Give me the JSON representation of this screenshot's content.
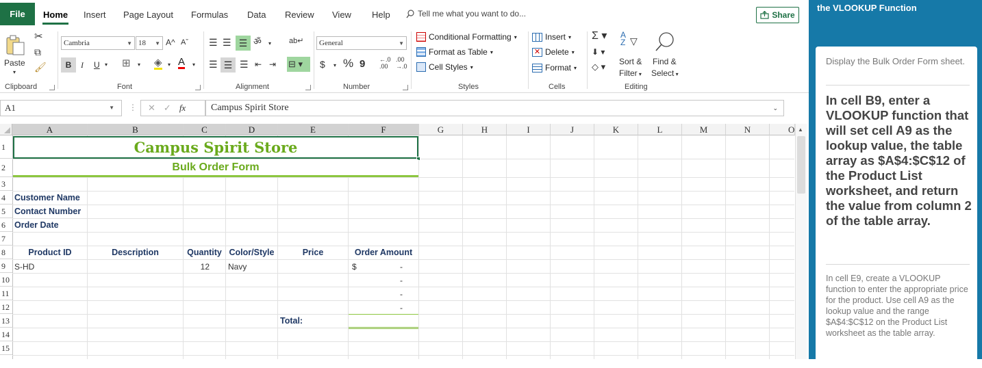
{
  "tabs": {
    "file": "File",
    "items": [
      "Home",
      "Insert",
      "Page Layout",
      "Formulas",
      "Data",
      "Review",
      "View",
      "Help"
    ],
    "tell_me": "Tell me what you want to do...",
    "share": "Share"
  },
  "ribbon": {
    "clipboard": {
      "paste": "Paste",
      "label": "Clipboard"
    },
    "font": {
      "name": "Cambria",
      "size": "18",
      "bold": "B",
      "italic": "I",
      "underline": "U",
      "grow": "A^",
      "shrink": "Aˇ",
      "label": "Font"
    },
    "alignment": {
      "label": "Alignment"
    },
    "number": {
      "format": "General",
      "currency": "$",
      "percent": "%",
      "comma": "9",
      "label": "Number"
    },
    "styles": {
      "conditional": "Conditional Formatting",
      "table": "Format as Table",
      "cell_styles": "Cell Styles",
      "label": "Styles"
    },
    "cells": {
      "insert": "Insert",
      "delete": "Delete",
      "format": "Format",
      "label": "Cells"
    },
    "editing": {
      "sort1": "Sort &",
      "sort2": "Filter",
      "find1": "Find &",
      "find2": "Select",
      "label": "Editing"
    }
  },
  "formula_bar": {
    "name_box": "A1",
    "fx": "fx",
    "content": "Campus Spirit Store"
  },
  "columns": [
    "A",
    "B",
    "C",
    "D",
    "E",
    "F",
    "G",
    "H",
    "I",
    "J",
    "K",
    "L",
    "M",
    "N",
    "O"
  ],
  "rows": [
    "1",
    "2",
    "3",
    "4",
    "5",
    "6",
    "7",
    "8",
    "9",
    "10",
    "11",
    "12",
    "13",
    "14",
    "15"
  ],
  "sheet": {
    "title": "Campus Spirit Store",
    "subtitle": "Bulk Order Form",
    "customer_name": "Customer Name",
    "contact_number": "Contact Number",
    "order_date": "Order Date",
    "headers": [
      "Product ID",
      "Description",
      "Quantity",
      "Color/Style",
      "Price",
      "Order Amount"
    ],
    "row9": {
      "product_id": "S-HD",
      "quantity": "12",
      "color": "Navy",
      "currency": "$",
      "amount": "-"
    },
    "amount_dashes": [
      "-",
      "-",
      "-"
    ],
    "total_label": "Total:"
  },
  "panel": {
    "header": "the VLOOKUP Function",
    "step_prev": "Display the Bulk Order Form sheet.",
    "step_current": "In cell B9, enter a VLOOKUP function that will set cell A9 as the lookup value, the table array as $A$4:$C$12 of the Product List worksheet, and return the value from column 2 of the table array.",
    "step_next": "In cell E9, create a VLOOKUP function to enter the appropriate price for the product. Use cell A9 as the lookup value and the range $A$4:$C$12 on the Product List worksheet as the table array."
  },
  "colors": {
    "excel_green": "#1e7145",
    "title_green": "#6aaa1c",
    "label_navy": "#1f3864",
    "panel_blue": "#1679a8"
  }
}
